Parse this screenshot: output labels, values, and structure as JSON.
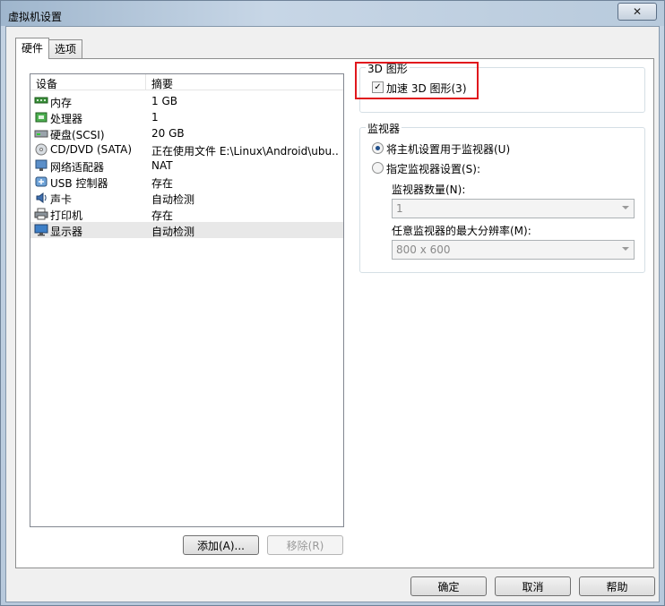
{
  "window": {
    "title": "虚拟机设置",
    "close_glyph": "✕"
  },
  "tabs": [
    {
      "label": "硬件"
    },
    {
      "label": "选项"
    }
  ],
  "devices": {
    "col_device": "设备",
    "col_summary": "摘要",
    "rows": [
      {
        "icon": "memory-icon",
        "name": "内存",
        "value": "1 GB"
      },
      {
        "icon": "processor-icon",
        "name": "处理器",
        "value": "1"
      },
      {
        "icon": "harddisk-icon",
        "name": "硬盘(SCSI)",
        "value": "20 GB"
      },
      {
        "icon": "cd-dvd-icon",
        "name": "CD/DVD (SATA)",
        "value": "正在使用文件 E:\\Linux\\Android\\ubu..."
      },
      {
        "icon": "network-adapter-icon",
        "name": "网络适配器",
        "value": "NAT"
      },
      {
        "icon": "usb-controller-icon",
        "name": "USB 控制器",
        "value": "存在"
      },
      {
        "icon": "sound-card-icon",
        "name": "声卡",
        "value": "自动检测"
      },
      {
        "icon": "printer-icon",
        "name": "打印机",
        "value": "存在"
      },
      {
        "icon": "display-icon",
        "name": "显示器",
        "value": "自动检测"
      }
    ]
  },
  "buttons": {
    "add": "添加(A)...",
    "remove": "移除(R)",
    "ok": "确定",
    "cancel": "取消",
    "help": "帮助"
  },
  "graphics": {
    "legend": "3D 图形",
    "accelerate_label": "加速 3D 图形(3)",
    "accelerate_checked": true
  },
  "monitor": {
    "legend": "监视器",
    "use_host_label": "将主机设置用于监视器(U)",
    "specify_label": "指定监视器设置(S):",
    "count_label": "监视器数量(N):",
    "count_value": "1",
    "maxres_label": "任意监视器的最大分辨率(M):",
    "maxres_value": "800 x 600"
  },
  "colors": {
    "highlight": "#e0171d",
    "selected_row": "#e8e8e8"
  }
}
